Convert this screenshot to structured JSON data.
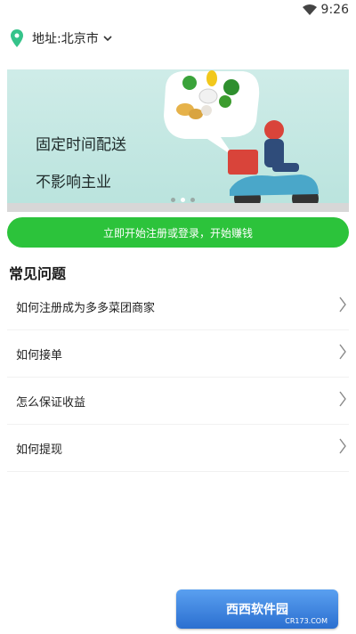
{
  "status": {
    "time": "9:26"
  },
  "address": {
    "label": "地址:北京市"
  },
  "banner": {
    "line1": "固定时间配送",
    "line2": "不影响主业"
  },
  "cta": {
    "label": "立即开始注册或登录，开始赚钱"
  },
  "faq": {
    "title": "常见问题",
    "items": [
      {
        "label": "如何注册成为多多菜团商家"
      },
      {
        "label": "如何接单"
      },
      {
        "label": "怎么保证收益"
      },
      {
        "label": "如何提现"
      }
    ]
  },
  "watermark": {
    "label": "西西软件园",
    "sub": "CR173.COM"
  },
  "colors": {
    "accent": "#2cc33b",
    "pin": "#35c38a"
  }
}
